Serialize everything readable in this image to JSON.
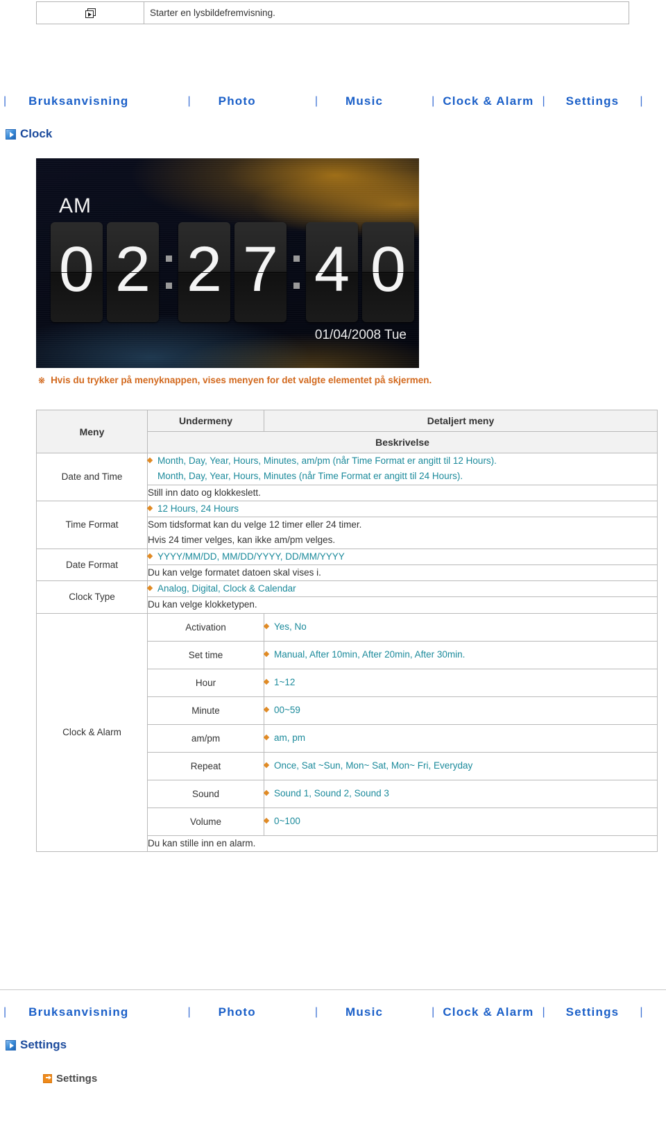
{
  "top_fragment": {
    "icon": "slideshow-icon",
    "text": "Starter en lysbildefremvisning."
  },
  "nav": {
    "separator": "|",
    "items": [
      {
        "label": "Bruksanvisning"
      },
      {
        "label": "Photo"
      },
      {
        "label": "Music"
      },
      {
        "label": "Clock & Alarm"
      },
      {
        "label": "Settings"
      }
    ]
  },
  "sections": {
    "clock_heading": "Clock",
    "settings_heading": "Settings",
    "settings_subheading": "Settings"
  },
  "clock_screenshot": {
    "ampm": "AM",
    "digits": [
      "0",
      "2",
      "2",
      "7",
      "4",
      "0"
    ],
    "date": "01/04/2008 Tue"
  },
  "note": {
    "mark": "※",
    "text": "Hvis du trykker på menyknappen, vises menyen for det valgte elementet på skjermen."
  },
  "table": {
    "headers": {
      "menu": "Meny",
      "submenu": "Undermeny",
      "detail": "Detaljert meny",
      "description": "Beskrivelse"
    },
    "rows": [
      {
        "menu": "Date and Time",
        "detail_lines": [
          "Month, Day, Year, Hours, Minutes, am/pm (når Time Format er angitt til 12 Hours).",
          "Month, Day, Year, Hours, Minutes (når Time Format er angitt til 24 Hours)."
        ],
        "description_lines": [
          "Still inn dato og klokkeslett."
        ]
      },
      {
        "menu": "Time Format",
        "detail_lines": [
          "12 Hours, 24 Hours"
        ],
        "description_lines": [
          "Som tidsformat kan du velge 12 timer eller 24 timer.",
          "Hvis 24 timer velges, kan ikke am/pm velges."
        ]
      },
      {
        "menu": "Date Format",
        "detail_lines": [
          "YYYY/MM/DD, MM/DD/YYYY, DD/MM/YYYY"
        ],
        "description_lines": [
          "Du kan velge formatet datoen skal vises i."
        ]
      },
      {
        "menu": "Clock Type",
        "detail_lines": [
          "Analog, Digital, Clock & Calendar"
        ],
        "description_lines": [
          "Du kan velge klokketypen."
        ]
      }
    ],
    "alarm_group": {
      "menu": "Clock & Alarm",
      "items": [
        {
          "submenu": "Activation",
          "detail": "Yes, No"
        },
        {
          "submenu": "Set time",
          "detail": "Manual, After 10min, After 20min, After 30min."
        },
        {
          "submenu": "Hour",
          "detail": "1~12"
        },
        {
          "submenu": "Minute",
          "detail": "00~59"
        },
        {
          "submenu": "am/pm",
          "detail": "am, pm"
        },
        {
          "submenu": "Repeat",
          "detail": "Once, Sat ~Sun, Mon~ Sat, Mon~ Fri, Everyday"
        },
        {
          "submenu": "Sound",
          "detail": "Sound 1, Sound 2, Sound 3"
        },
        {
          "submenu": "Volume",
          "detail": "0~100"
        }
      ],
      "description": "Du kan stille inn en alarm."
    }
  },
  "colors": {
    "nav_link": "#1a5fc8",
    "detail_text": "#1b8a9b",
    "note_text": "#d2691e",
    "bullet": "#e08a24",
    "heading": "#1b4a9c"
  }
}
